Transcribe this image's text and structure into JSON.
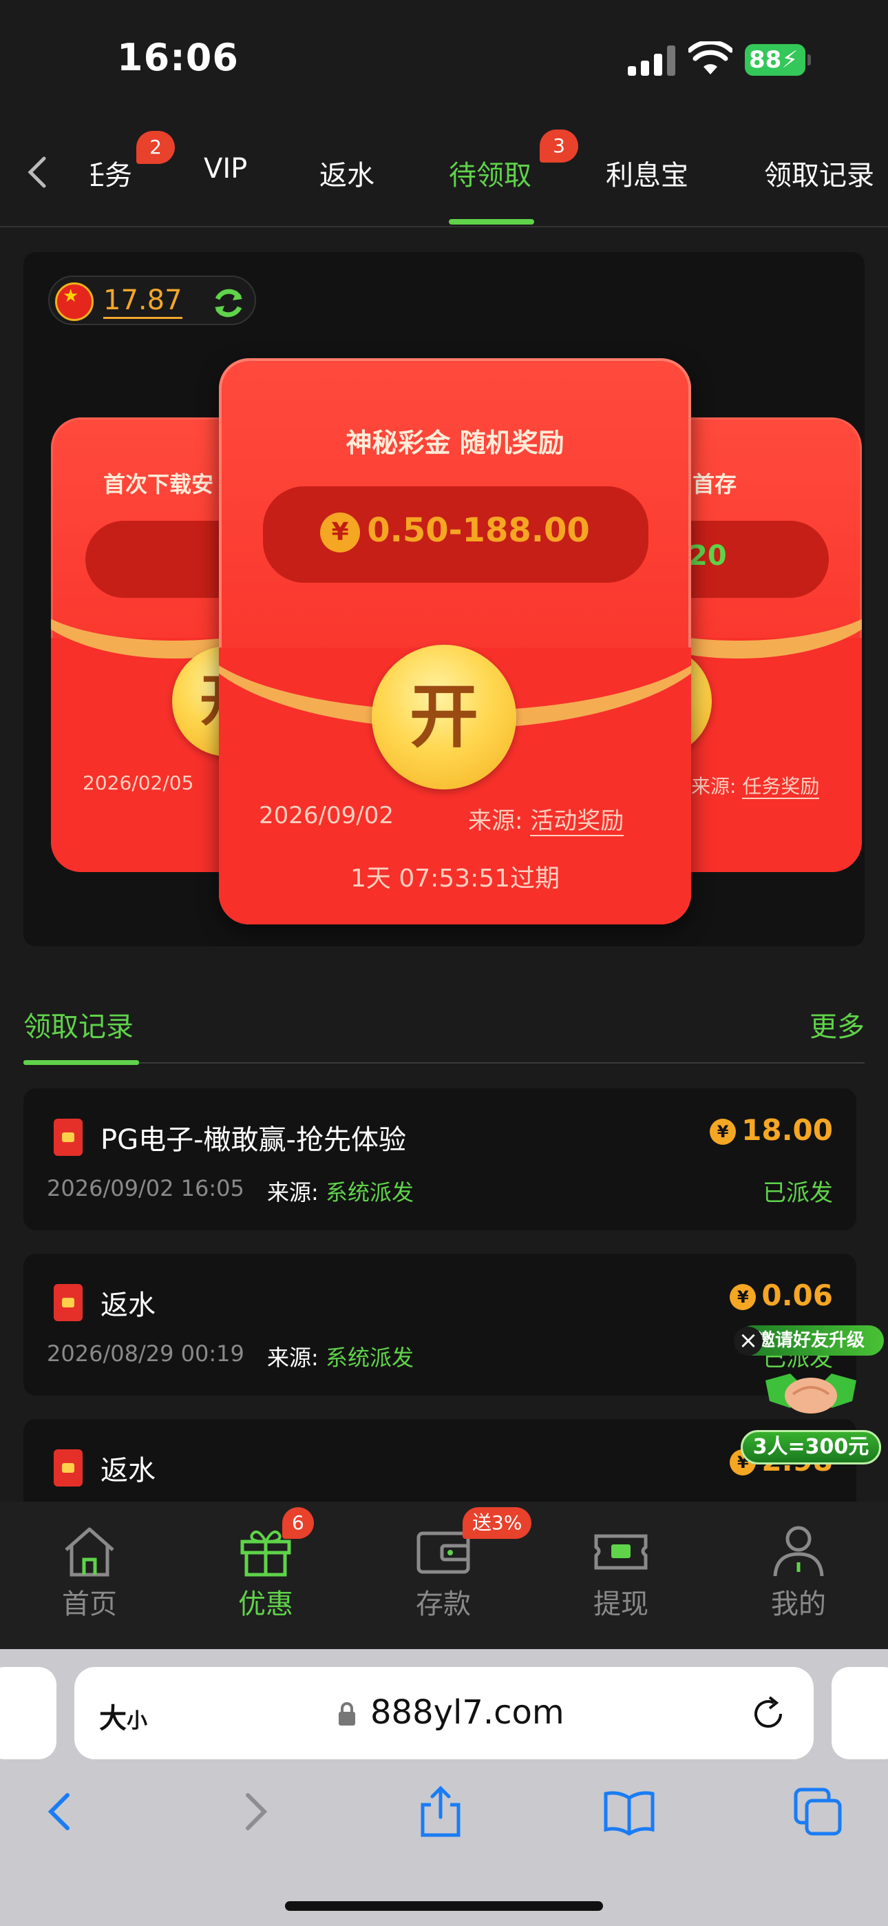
{
  "status": {
    "time": "16:06",
    "battery": "88"
  },
  "tabs": {
    "items": [
      {
        "label": "任务",
        "badge": "2"
      },
      {
        "label": "VIP"
      },
      {
        "label": "返水"
      },
      {
        "label": "待领取",
        "badge": "3"
      },
      {
        "label": "利息宝"
      },
      {
        "label": "领取记录"
      }
    ],
    "active": "待领取"
  },
  "balance": {
    "value": "17.87"
  },
  "cards": {
    "left": {
      "title": "首次下载安",
      "date": "2026/02/05",
      "open": "开"
    },
    "main": {
      "title": "神秘彩金 随机奖励",
      "amount": "0.50-188.00",
      "open": "开",
      "date": "2026/09/02",
      "source_label": "来源:",
      "source": "活动奖励",
      "expire": "1天 07:53:51过期"
    },
    "right": {
      "title": "首存",
      "amount": "20",
      "open": "开",
      "source_label": "来源:",
      "source": "任务奖励"
    }
  },
  "records": {
    "title": "领取记录",
    "more": "更多",
    "items": [
      {
        "name": "PG电子-橄敢赢-抢先体验",
        "time": "2026/09/02 16:05",
        "source_label": "来源:",
        "source": "系统派发",
        "amount": "18.00",
        "status": "已派发"
      },
      {
        "name": "返水",
        "time": "2026/08/29 00:19",
        "source_label": "来源:",
        "source": "系统派发",
        "amount": "0.06",
        "status": "已派发"
      },
      {
        "name": "返水",
        "amount": "2.98"
      }
    ]
  },
  "promo": {
    "top": "邀请好友升级",
    "bottom": "3人=300元"
  },
  "bottom_nav": {
    "items": [
      {
        "label": "首页"
      },
      {
        "label": "优惠",
        "badge": "6"
      },
      {
        "label": "存款",
        "badge": "送3%"
      },
      {
        "label": "提现"
      },
      {
        "label": "我的"
      }
    ]
  },
  "browser": {
    "text_size": "大",
    "text_size_small": "小",
    "url": "888yl7.com"
  },
  "colors": {
    "accent": "#5fd34a",
    "gold": "#f5a623",
    "red": "#f5251f",
    "background": "#1b1b1b"
  }
}
